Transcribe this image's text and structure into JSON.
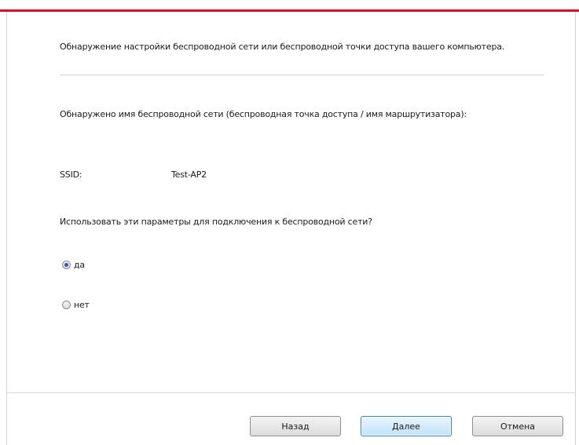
{
  "header_text": "Обнаружение настройки беспроводной сети или беспроводной точки доступа вашего компьютера.",
  "detected_label": "Обнаружено имя беспроводной сети (беспроводная точка доступа / имя маршрутизатора):",
  "ssid": {
    "label": "SSID:",
    "value": "Test-AP2"
  },
  "question": "Использовать эти параметры для подключения к беспроводной сети?",
  "options": [
    {
      "label": "да",
      "checked": true
    },
    {
      "label": "нет",
      "checked": false
    }
  ],
  "buttons": {
    "back": "Назад",
    "next": "Далее",
    "cancel": "Отмена"
  },
  "colors": {
    "accent": "#d0102a",
    "default_button": "#3c7fb1"
  }
}
